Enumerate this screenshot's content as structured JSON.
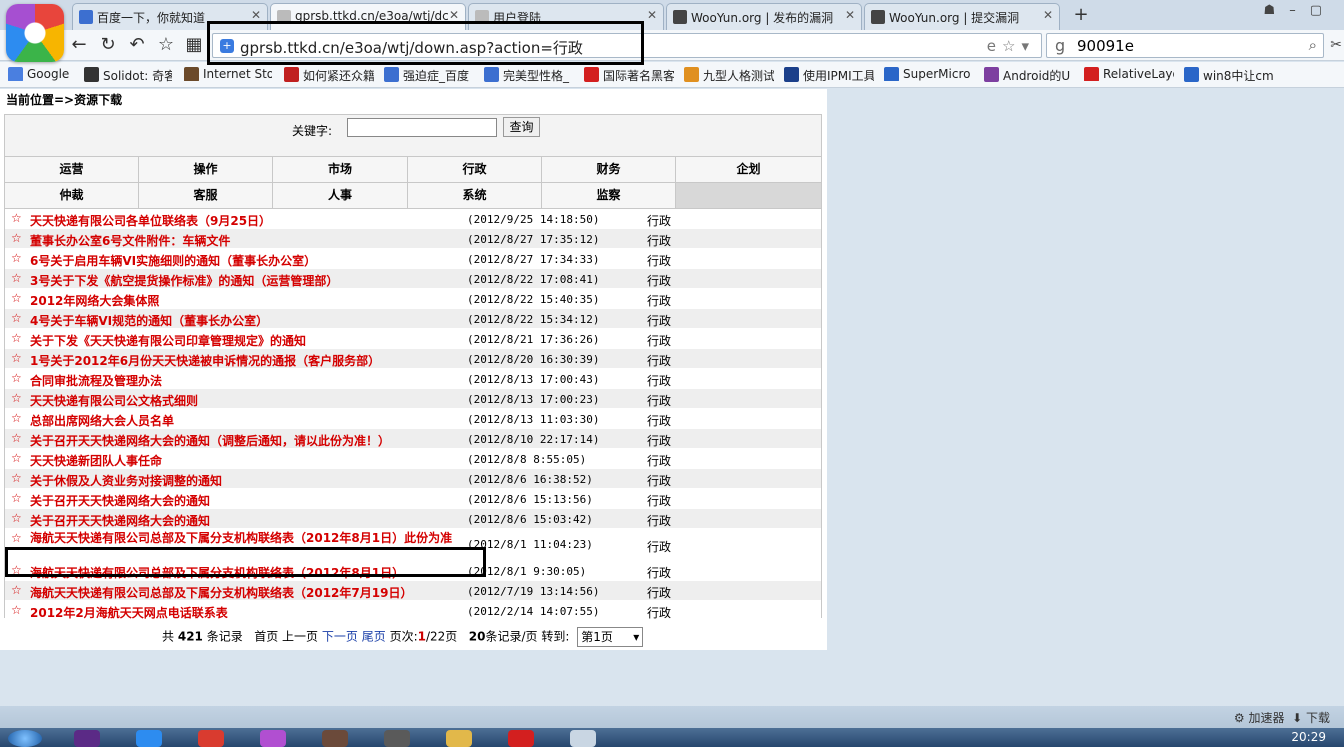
{
  "browser": {
    "tabs": [
      {
        "label": "百度一下，你就知道",
        "active": false
      },
      {
        "label": "gprsb.ttkd.cn/e3oa/wtj/dc",
        "active": true
      },
      {
        "label": "用户登陆",
        "active": false
      },
      {
        "label": "WooYun.org | 发布的漏洞",
        "active": false
      },
      {
        "label": "WooYun.org | 提交漏洞",
        "active": false
      }
    ],
    "new_tab": "+",
    "url": "gprsb.ttkd.cn/e3oa/wtj/down.asp?action=行政",
    "search_value": "90091e",
    "bookmarks": [
      "Google",
      "Solidot: 奇客",
      "Internet Sto",
      "如何紧还众籍",
      "强迫症_百度",
      "完美型性格_",
      "国际著名黑客",
      "九型人格测试",
      "使用IPMI工具",
      "SuperMicro",
      "Android的U",
      "RelativeLayo",
      "win8中让cm"
    ]
  },
  "page": {
    "breadcrumb": "当前位置=>资源下载",
    "keyword_label": "关键字:",
    "keyword_value": "",
    "query_button": "查询",
    "categories_row1": [
      "运营",
      "操作",
      "市场",
      "行政",
      "财务",
      "企划"
    ],
    "categories_row2": [
      "仲裁",
      "客服",
      "人事",
      "系统",
      "监察"
    ],
    "star": "☆",
    "docs": [
      {
        "title": "天天快递有限公司各单位联络表（9月25日）",
        "date": "(2012/9/25 14:18:50)",
        "category": "行政"
      },
      {
        "title": "董事长办公室6号文件附件：车辆文件",
        "date": "(2012/8/27 17:35:12)",
        "category": "行政"
      },
      {
        "title": "6号关于启用车辆VI实施细则的通知（董事长办公室）",
        "date": "(2012/8/27 17:34:33)",
        "category": "行政"
      },
      {
        "title": "3号关于下发《航空提货操作标准》的通知（运营管理部）",
        "date": "(2012/8/22 17:08:41)",
        "category": "行政"
      },
      {
        "title": "2012年网络大会集体照",
        "date": "(2012/8/22 15:40:35)",
        "category": "行政"
      },
      {
        "title": "4号关于车辆VI规范的通知（董事长办公室）",
        "date": "(2012/8/22 15:34:12)",
        "category": "行政"
      },
      {
        "title": "关于下发《天天快递有限公司印章管理规定》的通知",
        "date": "(2012/8/21 17:36:26)",
        "category": "行政"
      },
      {
        "title": "1号关于2012年6月份天天快递被申诉情况的通报（客户服务部）",
        "date": "(2012/8/20 16:30:39)",
        "category": "行政"
      },
      {
        "title": "合同审批流程及管理办法",
        "date": "(2012/8/13 17:00:43)",
        "category": "行政"
      },
      {
        "title": "天天快递有限公司公文格式细则",
        "date": "(2012/8/13 17:00:23)",
        "category": "行政"
      },
      {
        "title": "总部出席网络大会人员名单",
        "date": "(2012/8/13 11:03:30)",
        "category": "行政"
      },
      {
        "title": "关于召开天天快递网络大会的通知（调整后通知，请以此份为准！）",
        "date": "(2012/8/10 22:17:14)",
        "category": "行政"
      },
      {
        "title": "天天快递新团队人事任命",
        "date": "(2012/8/8 8:55:05)",
        "category": "行政"
      },
      {
        "title": "关于休假及人资业务对接调整的通知",
        "date": "(2012/8/6 16:38:52)",
        "category": "行政"
      },
      {
        "title": "关于召开天天快递网络大会的通知",
        "date": "(2012/8/6 15:13:56)",
        "category": "行政"
      },
      {
        "title": "关于召开天天快递网络大会的通知",
        "date": "(2012/8/6 15:03:42)",
        "category": "行政"
      },
      {
        "title": "海航天天快递有限公司总部及下属分支机构联络表（2012年8月1日）此份为准",
        "date": "(2012/8/1 11:04:23)",
        "category": "行政"
      },
      {
        "title": "海航天天快递有限公司总部及下属分支机构联络表（2012年8月1日）",
        "date": "(2012/8/1 9:30:05)",
        "category": "行政"
      },
      {
        "title": "海航天天快递有限公司总部及下属分支机构联络表（2012年7月19日）",
        "date": "(2012/7/19 13:14:56)",
        "category": "行政"
      },
      {
        "title": "2012年2月海航天天网点电话联系表",
        "date": "(2012/2/14 14:07:55)",
        "category": "行政"
      }
    ],
    "pager": {
      "total_prefix": "共",
      "total": "421",
      "total_suffix": "条记录",
      "first": "首页",
      "prev": "上一页",
      "next": "下一页",
      "last": "尾页",
      "pages_label": "页次:",
      "current": "1",
      "total_pages": "/22页",
      "per_page": "20",
      "per_page_suffix": "条记录/页",
      "goto": "转到:",
      "select_value": "第1页"
    }
  },
  "statusbar": {
    "accelerator": "加速器",
    "download": "下载"
  },
  "clock": "20:29",
  "colors": {
    "link_red": "#d40000",
    "link_blue": "#1a3fa8",
    "background": "#d9e4ee"
  }
}
